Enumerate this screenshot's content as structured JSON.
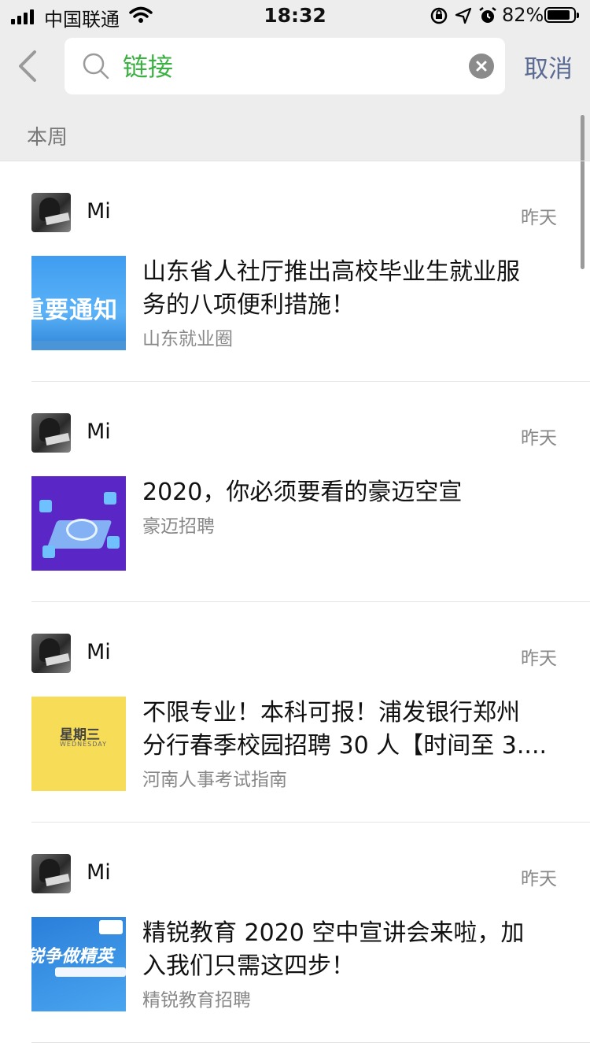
{
  "status_bar": {
    "carrier": "中国联通",
    "time": "18:32",
    "battery": "82%"
  },
  "search": {
    "query": "链接",
    "cancel_label": "取消"
  },
  "section_header": "本周",
  "results": [
    {
      "sender": "Mi",
      "date": "昨天",
      "title_lines": [
        "山东省人社厅推出高校毕业生就业服",
        "务的八项便利措施！"
      ],
      "source": "山东就业圈",
      "thumb_text": "重要通知"
    },
    {
      "sender": "Mi",
      "date": "昨天",
      "title_lines": [
        "2020，你必须要看的豪迈空宣"
      ],
      "source": "豪迈招聘"
    },
    {
      "sender": "Mi",
      "date": "昨天",
      "title_lines": [
        "不限专业！本科可报！浦发银行郑州",
        "分行春季校园招聘 30 人【时间至 3...."
      ],
      "source": "河南人事考试指南",
      "thumb_text": "星期三",
      "thumb_subtext": "WEDNESDAY"
    },
    {
      "sender": "Mi",
      "date": "昨天",
      "title_lines": [
        "精锐教育 2020 空中宣讲会来啦，加",
        "入我们只需这四步！"
      ],
      "source": "精锐教育招聘",
      "thumb_text": "锐争做精英"
    }
  ],
  "colors": {
    "query_text": "#3cb043",
    "cancel": "#5b6b93",
    "header_bg": "#ededed"
  }
}
